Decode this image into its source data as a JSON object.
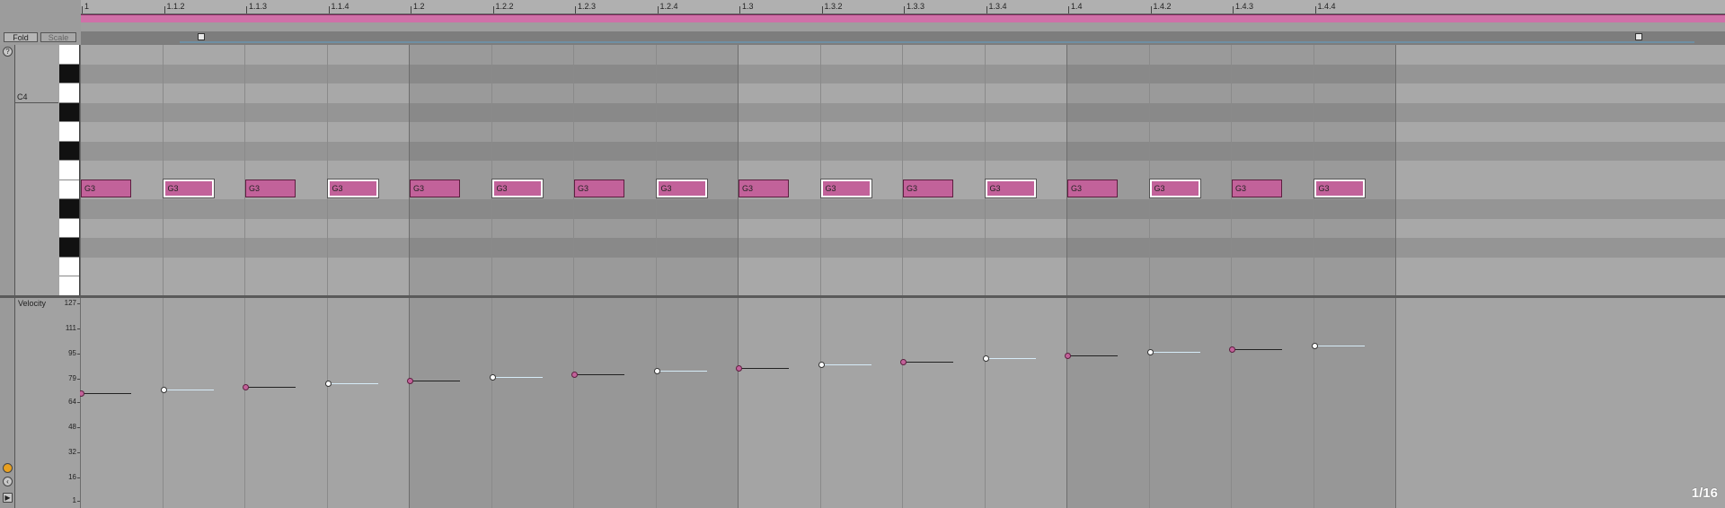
{
  "corner": {
    "fold_label": "Fold",
    "scale_label": "Scale"
  },
  "ruler": {
    "labels": [
      "1",
      "1.1.2",
      "1.1.3",
      "1.1.4",
      "1.2",
      "1.2.2",
      "1.2.3",
      "1.2.4",
      "1.3",
      "1.3.2",
      "1.3.3",
      "1.3.4",
      "1.4",
      "1.4.2",
      "1.4.3",
      "1.4.4"
    ]
  },
  "keys": {
    "c4_label": "C4"
  },
  "notes": [
    {
      "label": "G3",
      "selected": false
    },
    {
      "label": "G3",
      "selected": true
    },
    {
      "label": "G3",
      "selected": false
    },
    {
      "label": "G3",
      "selected": true
    },
    {
      "label": "G3",
      "selected": false
    },
    {
      "label": "G3",
      "selected": true
    },
    {
      "label": "G3",
      "selected": false
    },
    {
      "label": "G3",
      "selected": true
    },
    {
      "label": "G3",
      "selected": false
    },
    {
      "label": "G3",
      "selected": true
    },
    {
      "label": "G3",
      "selected": false
    },
    {
      "label": "G3",
      "selected": true
    },
    {
      "label": "G3",
      "selected": false
    },
    {
      "label": "G3",
      "selected": true
    },
    {
      "label": "G3",
      "selected": false
    },
    {
      "label": "G3",
      "selected": true
    }
  ],
  "velocity": {
    "title": "Velocity",
    "scale_labels": [
      "127",
      "111",
      "95",
      "79",
      "64",
      "48",
      "32",
      "16",
      "1"
    ],
    "values": [
      70,
      72,
      74,
      76,
      78,
      80,
      82,
      84,
      86,
      88,
      90,
      92,
      94,
      96,
      98,
      100
    ]
  },
  "grid_setting": "1/16",
  "colors": {
    "note_fill": "#c2629a",
    "clip_bar": "#d070a8",
    "selected_outline": "#ffffff",
    "velocity_selected_stem": "#d6ecf8"
  }
}
